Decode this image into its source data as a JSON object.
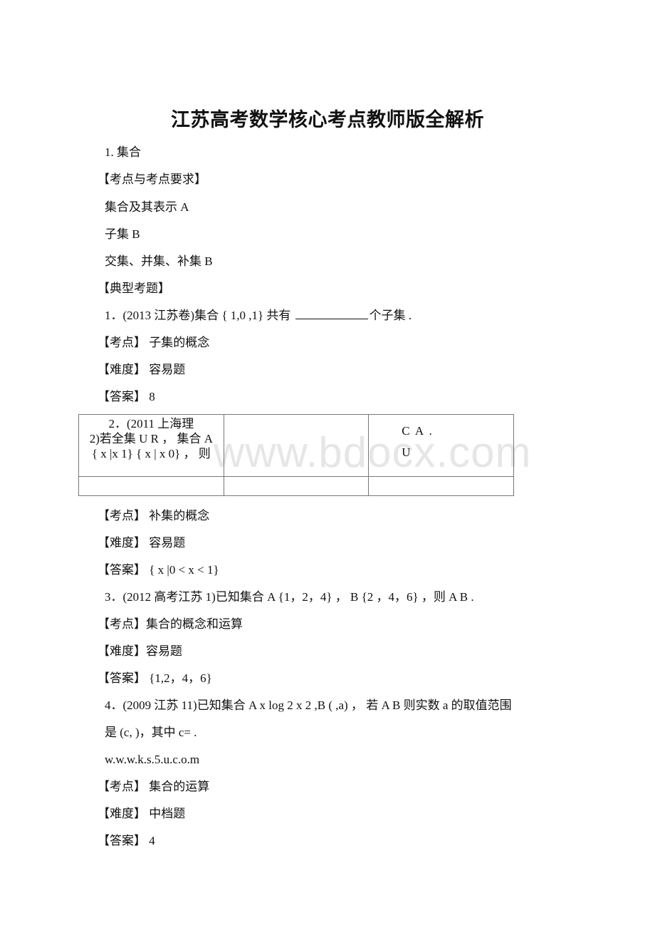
{
  "document": {
    "title": "江苏高考数学核心考点教师版全解析",
    "watermark": "www.bdocx.com",
    "section_heading": "1. 集合",
    "requirements_heading": "【考点与考点要求】",
    "requirements": [
      "集合及其表示 A",
      "子集 B",
      "交集、并集、补集 B"
    ],
    "typical_heading": "【典型考题】",
    "questions": [
      {
        "stem_before_blank": "1．(2013 江苏卷)集合 { 1,0 ,1} 共有 ",
        "stem_after_blank": "个子集 .",
        "point": "【考点】 子集的概念",
        "difficulty": "【难度】 容易题",
        "answer": "【答案】 8"
      },
      {
        "table": {
          "cell1_lines": [
            "2．(2011 上海理",
            "2)若全集 U R ， 集合 A",
            "{ x |x 1} { x | x 0} ， 则"
          ],
          "cell2": "",
          "cell3_lines": [
            "C A .",
            "U"
          ],
          "row2": [
            "",
            "",
            ""
          ]
        },
        "point": "【考点】 补集的概念",
        "difficulty": "【难度】 容易题",
        "answer": "【答案】 { x |0 < x < 1}"
      },
      {
        "stem": "3．(2012 高考江苏 1)已知集合 A {1，2，4} ， B {2 ，4，6} ，则 A B .",
        "point": "【考点】集合的概念和运算",
        "difficulty": "【难度】容易题",
        "answer": "【答案】 {1,2，4，6}"
      },
      {
        "stem_line1": "4．(2009 江苏 11)已知集合 A x log 2 x 2 ,B ( ,a) ， 若 A B 则实数 a 的取值范围",
        "stem_line2": "是 (c, )，其中 c= .",
        "source": "w.w.w.k.s.5.u.c.o.m",
        "point": "【考点】 集合的运算",
        "difficulty": "【难度】 中档题",
        "answer": "【答案】 4"
      }
    ]
  }
}
